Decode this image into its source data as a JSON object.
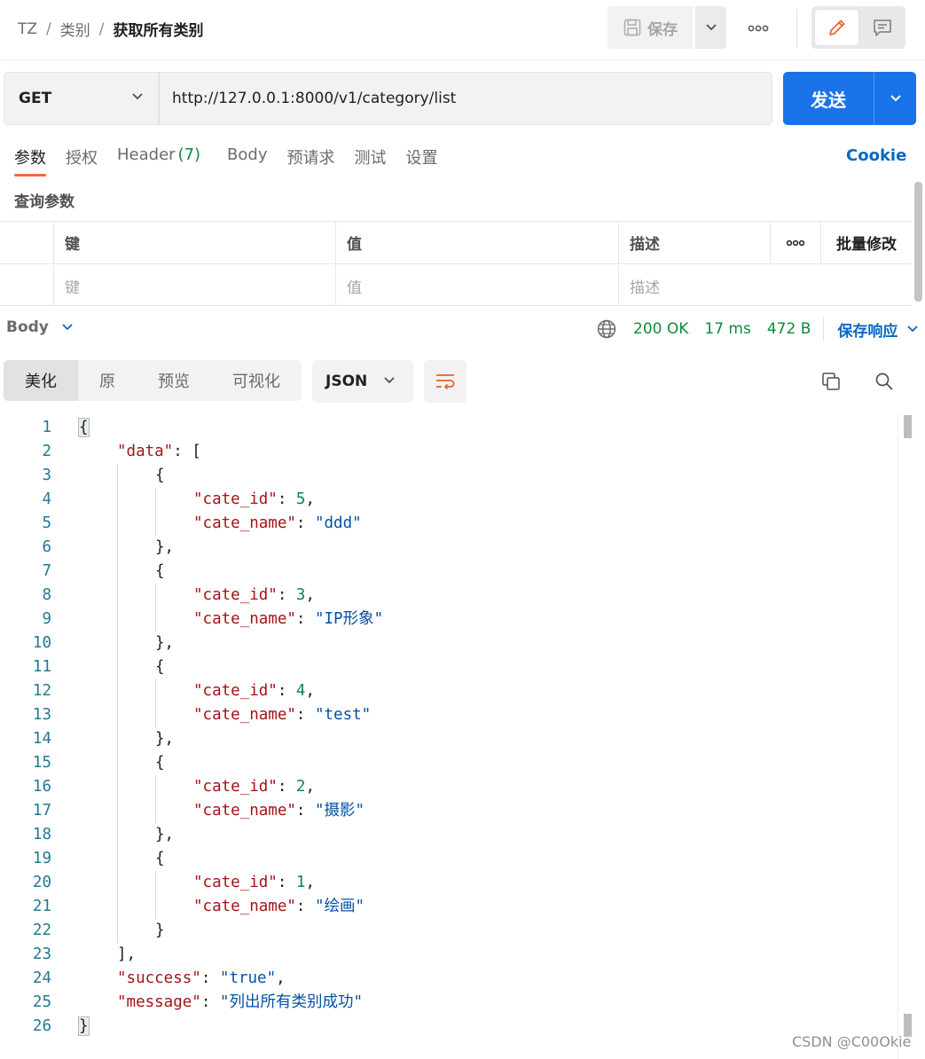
{
  "breadcrumb": {
    "workspace": "TZ",
    "folder": "类别",
    "request": "获取所有类别",
    "separator": "/"
  },
  "toolbar": {
    "save_label": "保存",
    "more_icon": "more-horizontal-icon",
    "edit_icon": "pencil-icon",
    "doc_icon": "comment-icon"
  },
  "request": {
    "method": "GET",
    "url": "http://127.0.0.1:8000/v1/category/list",
    "send_label": "发送"
  },
  "request_tabs": [
    {
      "label": "参数",
      "count": ""
    },
    {
      "label": "授权",
      "count": ""
    },
    {
      "label": "Header",
      "count": "(7)"
    },
    {
      "label": "Body",
      "count": ""
    },
    {
      "label": "预请求",
      "count": ""
    },
    {
      "label": "测试",
      "count": ""
    },
    {
      "label": "设置",
      "count": ""
    }
  ],
  "cookie_label": "Cookie",
  "query_params": {
    "title": "查询参数",
    "headers": {
      "key": "键",
      "value": "值",
      "description": "描述",
      "bulk_edit": "批量修改"
    },
    "placeholders": {
      "key": "键",
      "value": "值",
      "description": "描述"
    }
  },
  "response": {
    "body_label": "Body",
    "status": "200 OK",
    "time": "17 ms",
    "size": "472 B",
    "save_label": "保存响应",
    "view_tabs": [
      "美化",
      "原",
      "预览",
      "可视化"
    ],
    "format": "JSON"
  },
  "code_lines": [
    {
      "n": "1",
      "d": 0,
      "t": [
        [
          "p",
          "{"
        ]
      ],
      "bm": true
    },
    {
      "n": "2",
      "d": 1,
      "t": [
        [
          "k",
          "\"data\""
        ],
        [
          "p",
          ": ["
        ]
      ]
    },
    {
      "n": "3",
      "d": 2,
      "t": [
        [
          "p",
          "{"
        ]
      ]
    },
    {
      "n": "4",
      "d": 3,
      "t": [
        [
          "k",
          "\"cate_id\""
        ],
        [
          "p",
          ": "
        ],
        [
          "n",
          "5"
        ],
        [
          "p",
          ","
        ]
      ]
    },
    {
      "n": "5",
      "d": 3,
      "t": [
        [
          "k",
          "\"cate_name\""
        ],
        [
          "p",
          ": "
        ],
        [
          "s",
          "\"ddd\""
        ]
      ]
    },
    {
      "n": "6",
      "d": 2,
      "t": [
        [
          "p",
          "},"
        ]
      ]
    },
    {
      "n": "7",
      "d": 2,
      "t": [
        [
          "p",
          "{"
        ]
      ]
    },
    {
      "n": "8",
      "d": 3,
      "t": [
        [
          "k",
          "\"cate_id\""
        ],
        [
          "p",
          ": "
        ],
        [
          "n",
          "3"
        ],
        [
          "p",
          ","
        ]
      ]
    },
    {
      "n": "9",
      "d": 3,
      "t": [
        [
          "k",
          "\"cate_name\""
        ],
        [
          "p",
          ": "
        ],
        [
          "s",
          "\"IP形象\""
        ]
      ]
    },
    {
      "n": "10",
      "d": 2,
      "t": [
        [
          "p",
          "},"
        ]
      ]
    },
    {
      "n": "11",
      "d": 2,
      "t": [
        [
          "p",
          "{"
        ]
      ]
    },
    {
      "n": "12",
      "d": 3,
      "t": [
        [
          "k",
          "\"cate_id\""
        ],
        [
          "p",
          ": "
        ],
        [
          "n",
          "4"
        ],
        [
          "p",
          ","
        ]
      ]
    },
    {
      "n": "13",
      "d": 3,
      "t": [
        [
          "k",
          "\"cate_name\""
        ],
        [
          "p",
          ": "
        ],
        [
          "s",
          "\"test\""
        ]
      ]
    },
    {
      "n": "14",
      "d": 2,
      "t": [
        [
          "p",
          "},"
        ]
      ]
    },
    {
      "n": "15",
      "d": 2,
      "t": [
        [
          "p",
          "{"
        ]
      ]
    },
    {
      "n": "16",
      "d": 3,
      "t": [
        [
          "k",
          "\"cate_id\""
        ],
        [
          "p",
          ": "
        ],
        [
          "n",
          "2"
        ],
        [
          "p",
          ","
        ]
      ]
    },
    {
      "n": "17",
      "d": 3,
      "t": [
        [
          "k",
          "\"cate_name\""
        ],
        [
          "p",
          ": "
        ],
        [
          "s",
          "\"摄影\""
        ]
      ]
    },
    {
      "n": "18",
      "d": 2,
      "t": [
        [
          "p",
          "},"
        ]
      ]
    },
    {
      "n": "19",
      "d": 2,
      "t": [
        [
          "p",
          "{"
        ]
      ]
    },
    {
      "n": "20",
      "d": 3,
      "t": [
        [
          "k",
          "\"cate_id\""
        ],
        [
          "p",
          ": "
        ],
        [
          "n",
          "1"
        ],
        [
          "p",
          ","
        ]
      ]
    },
    {
      "n": "21",
      "d": 3,
      "t": [
        [
          "k",
          "\"cate_name\""
        ],
        [
          "p",
          ": "
        ],
        [
          "s",
          "\"绘画\""
        ]
      ]
    },
    {
      "n": "22",
      "d": 2,
      "t": [
        [
          "p",
          "}"
        ]
      ]
    },
    {
      "n": "23",
      "d": 1,
      "t": [
        [
          "p",
          "],"
        ]
      ]
    },
    {
      "n": "24",
      "d": 1,
      "t": [
        [
          "k",
          "\"success\""
        ],
        [
          "p",
          ": "
        ],
        [
          "s",
          "\"true\""
        ],
        [
          "p",
          ","
        ]
      ]
    },
    {
      "n": "25",
      "d": 1,
      "t": [
        [
          "k",
          "\"message\""
        ],
        [
          "p",
          ": "
        ],
        [
          "s",
          "\"列出所有类别成功\""
        ]
      ]
    },
    {
      "n": "26",
      "d": 0,
      "t": [
        [
          "p",
          "}"
        ]
      ],
      "bm": true
    }
  ],
  "watermark": "CSDN @C00Okie",
  "colors": {
    "accent": "#1a73e8",
    "tab_indicator": "#f26b3a",
    "status_ok": "#0f8a3c",
    "link": "#0b67c2",
    "json_key": "#a31515",
    "json_string": "#0451a5",
    "json_number": "#098658",
    "line_number": "#237893"
  }
}
